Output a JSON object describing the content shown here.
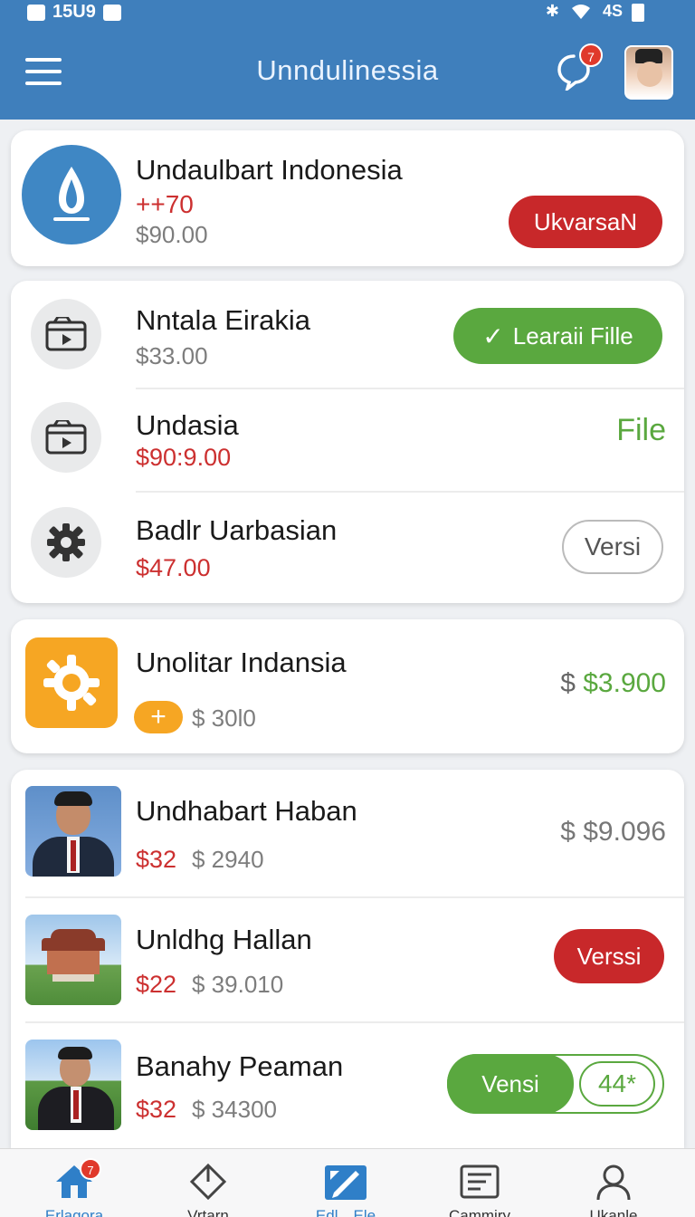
{
  "status_bar": {
    "time": "15U9",
    "network": "4S"
  },
  "header": {
    "title": "Unndulinessia",
    "chat_badge": "7"
  },
  "featured": {
    "title": "Undaulbart Indonesia",
    "change": "++70",
    "price": "$90.00",
    "button": "UkvarsaN",
    "icon": "drop-icon",
    "icon_color": "#3f87c4"
  },
  "files": [
    {
      "title": "Nntala Eirakia",
      "price": "$33.00",
      "action": "Learaii Fille",
      "icon": "video-file-icon"
    },
    {
      "title": "Undasia",
      "price": "$90:9.00",
      "action": "File",
      "icon": "video-file-icon"
    },
    {
      "title": "Badlr Uarbasian",
      "price": "$47.00",
      "action": "Versi",
      "icon": "gear-icon"
    }
  ],
  "promo": {
    "title": "Unolitar Indansia",
    "add_label": "+",
    "sub_price": "$ 30l0",
    "currency": "$",
    "price": "$3.900",
    "icon": "orange-gear-icon",
    "icon_color": "#f6a623"
  },
  "people": [
    {
      "title": "Undhabart Haban",
      "red": "$32",
      "gray": "$ 2940",
      "right_text": "$ $9.096",
      "thumb": "portrait-photo"
    },
    {
      "title": "Unldhg Hallan",
      "red": "$22",
      "gray": "$ 39.010",
      "button": "Verssi",
      "thumb": "building-photo"
    },
    {
      "title": "Banahy Peaman",
      "red": "$32",
      "gray": "$ 34300",
      "button": "Vensi",
      "count": "44*",
      "thumb": "portrait-photo-outdoor"
    }
  ],
  "bottom_nav": [
    {
      "label": "Erlagora",
      "icon": "home-icon",
      "badge": "7",
      "active": true
    },
    {
      "label": "Vrtarn",
      "icon": "diamond-icon"
    },
    {
      "label": "Edl…Ele",
      "icon": "edit-icon",
      "active": true
    },
    {
      "label": "Cammiry",
      "icon": "document-icon"
    },
    {
      "label": "Ukanle",
      "icon": "user-icon"
    }
  ],
  "colors": {
    "header": "#3f7fbc",
    "red": "#c8282a",
    "green": "#5aa83f",
    "orange": "#f6a623"
  }
}
